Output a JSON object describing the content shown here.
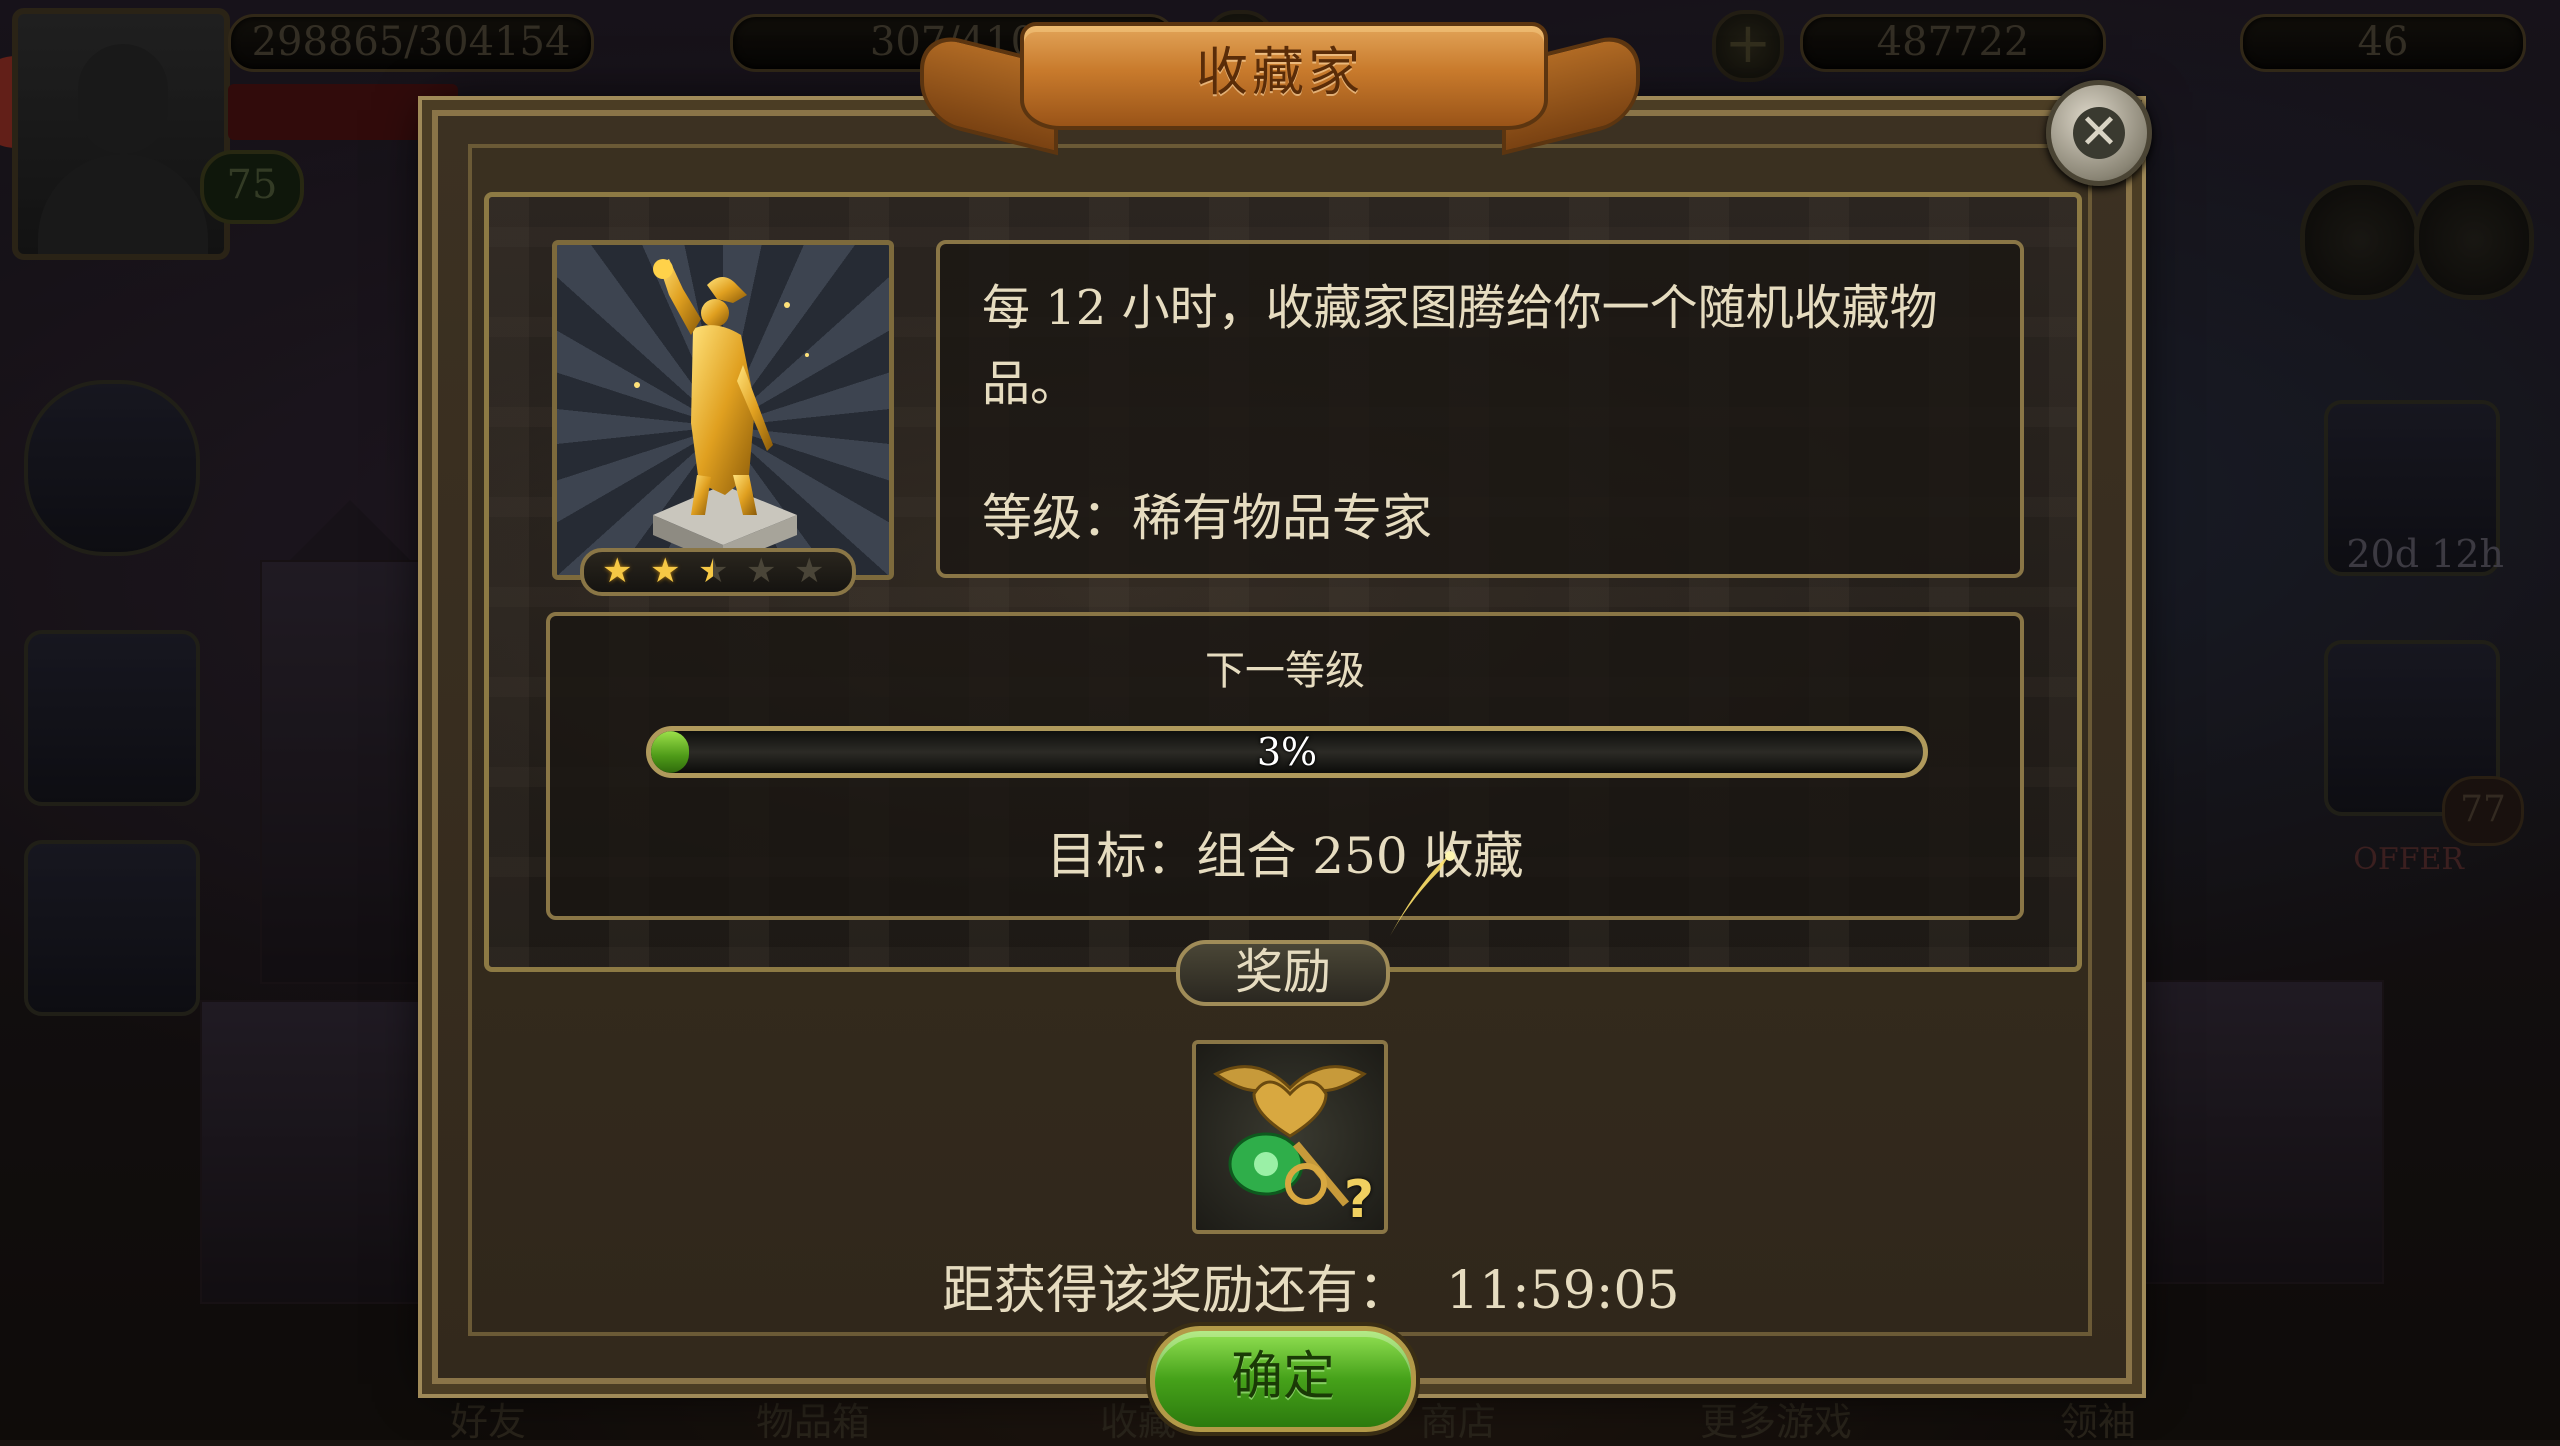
{
  "hud": {
    "xp": "298865/304154",
    "energy": "307/410",
    "coins": "487722",
    "gems": "46",
    "level": "75"
  },
  "side": {
    "offer_timer": "20d 12h",
    "chest_count": "77",
    "offer_label": "OFFER"
  },
  "bottom_nav": [
    "好友",
    "物品箱",
    "收藏",
    "商店",
    "更多游戏",
    "领袖"
  ],
  "dialog": {
    "title": "收藏家",
    "description": "每 12 小时，收藏家图腾给你一个随机收藏物品。",
    "level_line": "等级：稀有物品专家",
    "stars": {
      "filled": 2.5,
      "total": 5
    },
    "next_level_label": "下一等级",
    "progress": {
      "percent": 3,
      "text": "3%"
    },
    "goal": "目标：组合 250 收藏",
    "reward_tab": "奖励",
    "reward_q": "?",
    "reward_countdown_label": "距获得该奖励还有：",
    "reward_countdown_time": "11:59:05",
    "ok_label": "确定"
  },
  "colors": {
    "progress_green": "#4e9a18",
    "ribbon_gold": "#c87a2c",
    "ok_green": "#46a21a"
  }
}
